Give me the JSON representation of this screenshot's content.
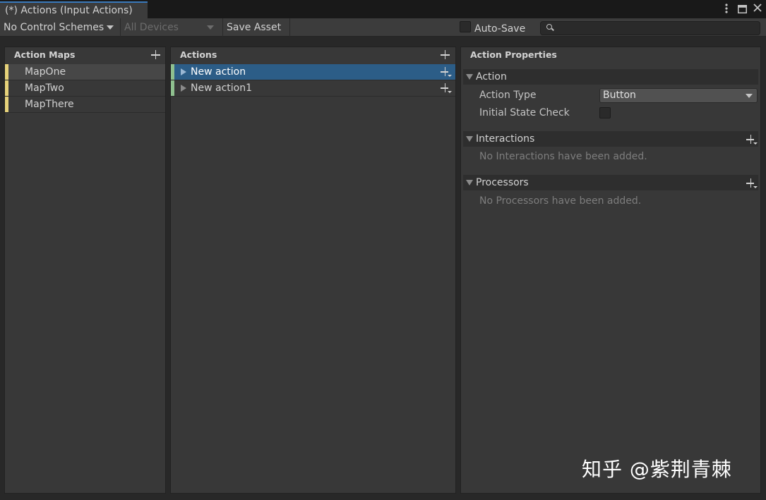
{
  "window": {
    "tab_title": "(*) Actions (Input Actions)",
    "menu_icon": "kebab-menu-icon",
    "maximize_icon": "maximize-icon"
  },
  "toolbar": {
    "control_schemes": "No Control Schemes",
    "devices": "All Devices",
    "save_asset": "Save Asset",
    "auto_save": "Auto-Save",
    "search_placeholder": ""
  },
  "action_maps": {
    "header": "Action Maps",
    "items": [
      {
        "label": "MapOne"
      },
      {
        "label": "MapTwo"
      },
      {
        "label": "MapThere"
      }
    ]
  },
  "actions": {
    "header": "Actions",
    "items": [
      {
        "label": "New action"
      },
      {
        "label": "New action1"
      }
    ]
  },
  "properties": {
    "header": "Action Properties",
    "action_section": "Action",
    "action_type_label": "Action Type",
    "action_type_value": "Button",
    "initial_state_label": "Initial State Check",
    "interactions_section": "Interactions",
    "interactions_empty": "No Interactions have been added.",
    "processors_section": "Processors",
    "processors_empty": "No Processors have been added."
  },
  "watermark": "知乎 @紫荆青棘",
  "colors": {
    "selection": "#2c5d87",
    "map_marker": "#e6d27a",
    "action_marker": "#8fc08f",
    "tab_accent": "#3a79bb"
  }
}
